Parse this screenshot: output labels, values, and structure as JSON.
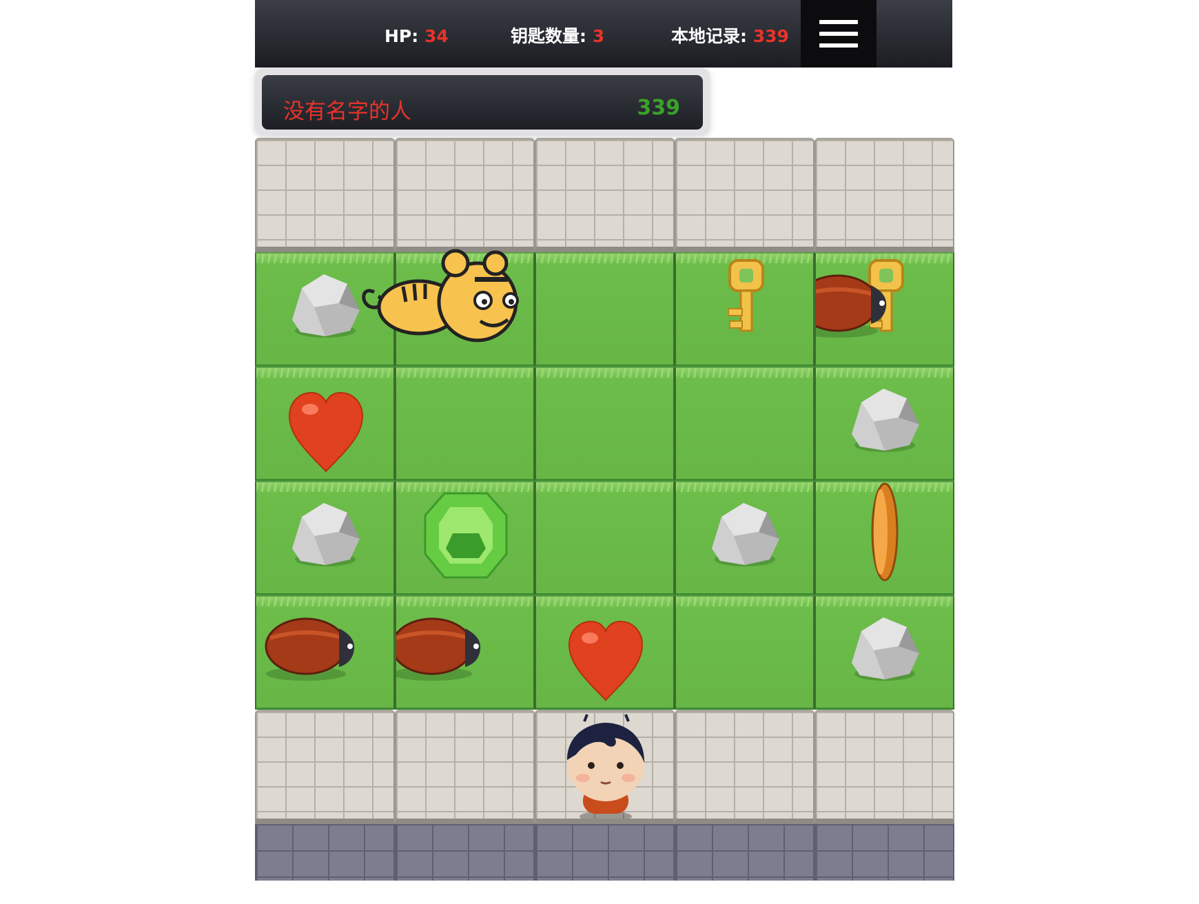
{
  "hud": {
    "hp_label": "HP:",
    "hp_value": "34",
    "keys_label": "钥匙数量:",
    "keys_value": "3",
    "record_label": "本地记录:",
    "record_value": "339",
    "menu_icon": "hamburger-menu-icon"
  },
  "leaderboard": {
    "name": "没有名字的人",
    "score": "339"
  },
  "board": {
    "columns": 5,
    "rows": [
      [
        "stone",
        "stone",
        "stone",
        "stone",
        "stone"
      ],
      [
        "rock",
        "tiger",
        "grass",
        "key",
        "beetle+key"
      ],
      [
        "heart",
        "grass",
        "grass",
        "grass",
        "rock"
      ],
      [
        "rock",
        "emerald",
        "grass",
        "rock",
        "coin"
      ],
      [
        "beetle",
        "beetle",
        "heart",
        "grass",
        "rock"
      ],
      [
        "stone",
        "stone",
        "player",
        "stone",
        "stone"
      ]
    ]
  },
  "colors": {
    "accent_red": "#e8332a",
    "score_green": "#3ca12a",
    "hud_dark": "#1b1d22",
    "grass": "#67b646",
    "stone": "#ddd9d0"
  }
}
